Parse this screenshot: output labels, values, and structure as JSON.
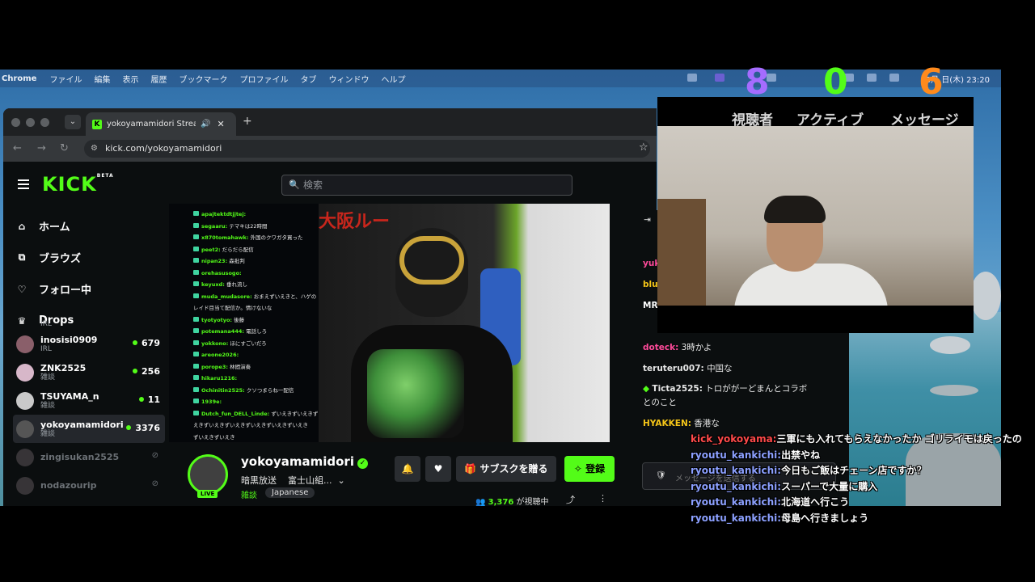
{
  "menubar": {
    "app": "Chrome",
    "items": [
      "ファイル",
      "編集",
      "表示",
      "履歴",
      "ブックマーク",
      "プロファイル",
      "タブ",
      "ウィンドウ",
      "ヘルプ"
    ],
    "clock": "8月 日(木)  23:20"
  },
  "browser": {
    "tab_title": "yokoyamamidori Stream -",
    "tab_favicon": "K",
    "url": "kick.com/yokoyamamidori"
  },
  "kick": {
    "logo": "KICK",
    "logo_beta": "BETA",
    "search_placeholder": "検索",
    "nav": [
      {
        "icon": "home-icon",
        "glyph": "⌂",
        "label": "ホーム"
      },
      {
        "icon": "browse-icon",
        "glyph": "⧉",
        "label": "ブラウズ"
      },
      {
        "icon": "heart-icon",
        "glyph": "♡",
        "label": "フォロー中"
      },
      {
        "icon": "drops-icon",
        "glyph": "♛",
        "label": "Drops"
      }
    ],
    "channels": [
      {
        "name": "",
        "cat": "IRL",
        "viewers": ""
      },
      {
        "name": "inosisi0909",
        "cat": "IRL",
        "viewers": "679"
      },
      {
        "name": "ZNK2525",
        "cat": "雑談",
        "viewers": "256"
      },
      {
        "name": "TSUYAMA_n",
        "cat": "雑談",
        "viewers": "11"
      },
      {
        "name": "yokoyamamidori",
        "cat": "雑談",
        "viewers": "3376"
      },
      {
        "name": "zingisukan2525",
        "cat": "",
        "viewers": ""
      },
      {
        "name": "nodazourip",
        "cat": "",
        "viewers": ""
      }
    ],
    "stream_chat": [
      {
        "u": "apajtektdtjjtej:",
        "m": ""
      },
      {
        "u": "segaaru:",
        "m": "テマキは22時間"
      },
      {
        "u": "x870tomahawk:",
        "m": "外国のクワガタ買った"
      },
      {
        "u": "peet2:",
        "m": "だらだら配信"
      },
      {
        "u": "nipan23:",
        "m": "森批判"
      },
      {
        "u": "orehasusogo:",
        "m": ""
      },
      {
        "u": "keyuxd:",
        "m": "垂れ流し"
      },
      {
        "u": "muda_mudasore:",
        "m": "おまえずいえきと、ハゲの"
      },
      {
        "u": "",
        "m": "レイド目当て配信か。情けないな"
      },
      {
        "u": "tyotyotyo:",
        "m": "後藤"
      },
      {
        "u": "potemana444:",
        "m": "電話しろ"
      },
      {
        "u": "yokkono:",
        "m": "ほにすごいだろ"
      },
      {
        "u": "areone2026:",
        "m": ""
      },
      {
        "u": "porope3:",
        "m": "林間演奏"
      },
      {
        "u": "hikaru1216:",
        "m": ""
      },
      {
        "u": "Ochinitin2525:",
        "m": "クソつまらね一配信"
      },
      {
        "u": "1939e:",
        "m": ""
      },
      {
        "u": "Dutch_fun_DELL_Linde:",
        "m": "ずいえきずいえきずいえき"
      },
      {
        "u": "",
        "m": "えきずいえきずいえきずいえきずいえきずいえき"
      },
      {
        "u": "",
        "m": "ずいえきずいえき"
      }
    ],
    "stream_banner": "大阪ルー",
    "channel": {
      "name": "yokoyamamidori",
      "title": "暗黒放送",
      "subtitle": "富士山組...",
      "category": "雑談",
      "tag": "Japanese",
      "live": "LIVE",
      "sub_button": "サブスクを贈る",
      "follow_button": "登録",
      "viewers": "3,376",
      "viewing_suffix": "が視聴中"
    },
    "chat": [
      {
        "u": "yuk",
        "m": "",
        "c": "#ff4a9a"
      },
      {
        "u": "blu",
        "m": "",
        "c": "#f5c518"
      },
      {
        "u": "MR",
        "m": "",
        "c": "#ffffff"
      },
      {
        "u": "doteck:",
        "m": "3時かよ",
        "c": "#ff4a9a"
      },
      {
        "u": "teruteru007:",
        "m": "中国な",
        "c": "#e6e6e6"
      },
      {
        "u": "Ticta2525:",
        "m": "トロががーどまんとコラボ",
        "c": "#e6e6e6"
      },
      {
        "u": "",
        "m": "とのこと",
        "c": "#e6e6e6"
      },
      {
        "u": "HYAKKEN:",
        "m": "香港な",
        "c": "#f5c518"
      }
    ],
    "chat_input_placeholder": "メッセージを送信する"
  },
  "overlay": {
    "labels": [
      "視聴者",
      "アクティブ",
      "メッセージ"
    ],
    "counters": [
      {
        "value": "8",
        "color": "#a56cff"
      },
      {
        "value": "0",
        "color": "#53fc18"
      },
      {
        "value": "6",
        "color": "#ff8a1c"
      }
    ],
    "chat": [
      {
        "u": "kick_yokoyama:",
        "m": "三軍にも入れてもらえなかったか ゴリライモは戻ったの",
        "red": true
      },
      {
        "u": "ryoutu_kankichi:",
        "m": "出禁やね",
        "red": false
      },
      {
        "u": "ryoutu_kankichi:",
        "m": "今日もご飯はチェーン店ですか？",
        "red": false
      },
      {
        "u": "ryoutu_kankichi:",
        "m": "スーパーで大量に購入",
        "red": false
      },
      {
        "u": "ryoutu_kankichi:",
        "m": "北海道へ行こう",
        "red": false
      },
      {
        "u": "ryoutu_kankichi:",
        "m": "母島へ行きましょう",
        "red": false
      }
    ]
  }
}
